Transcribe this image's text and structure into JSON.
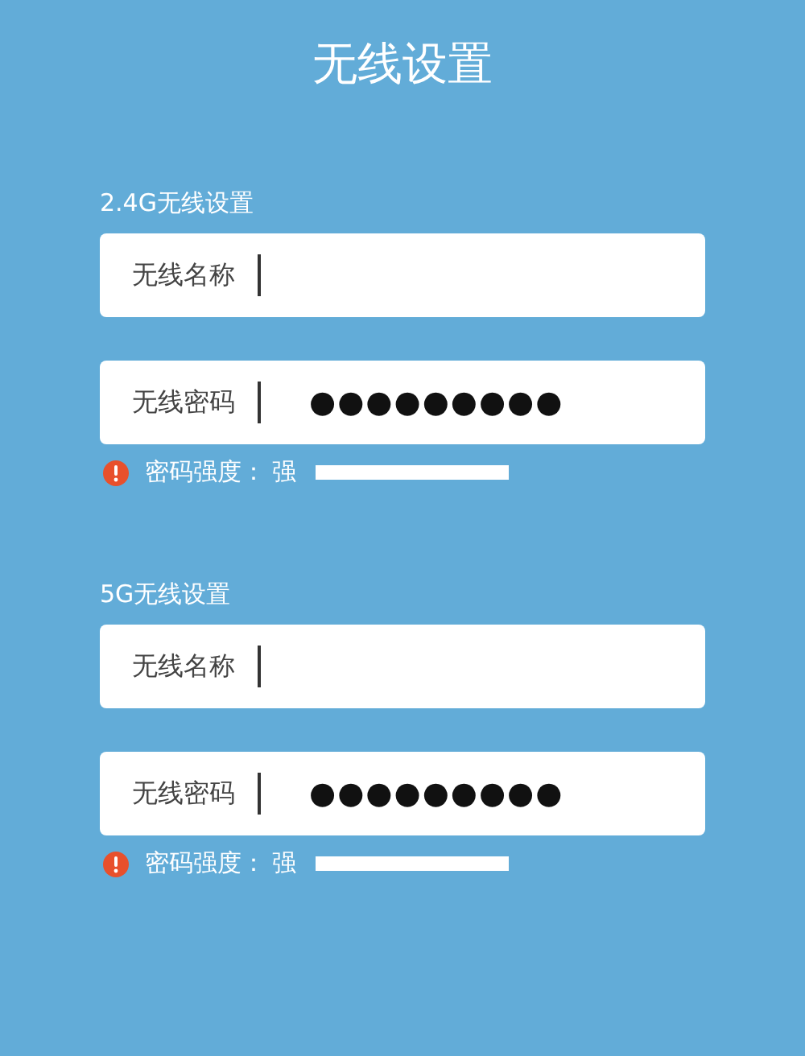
{
  "title": "无线设置",
  "sections": [
    {
      "heading": "2.4G无线设置",
      "fields": [
        {
          "label": "无线名称"
        },
        {
          "label": "无线密码",
          "value": "●●●●●●●●●"
        }
      ],
      "strength": {
        "label": "密码强度：",
        "value": "强"
      }
    },
    {
      "heading": "5G无线设置",
      "fields": [
        {
          "label": "无线名称"
        },
        {
          "label": "无线密码",
          "value": "●●●●●●●●●"
        }
      ],
      "strength": {
        "label": "密码强度：",
        "value": "强"
      }
    }
  ]
}
